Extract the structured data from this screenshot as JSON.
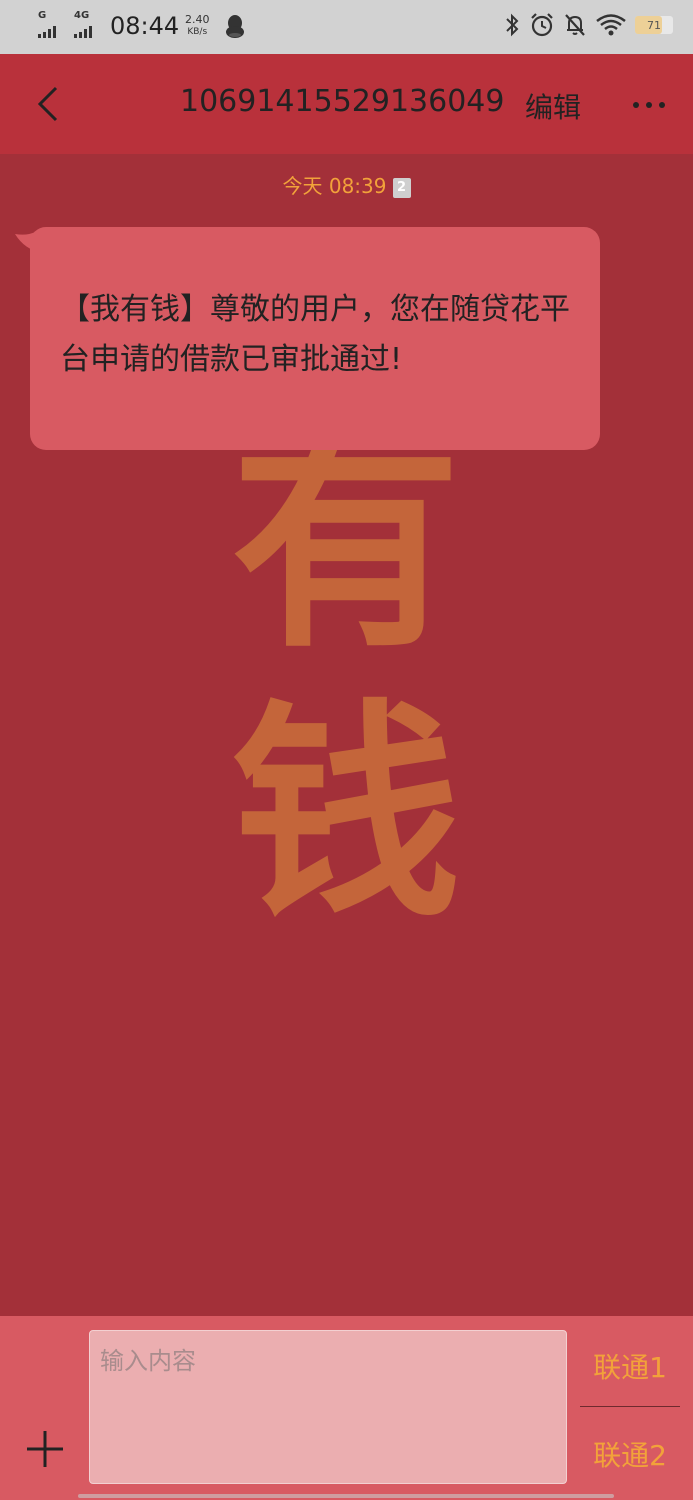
{
  "status_bar": {
    "net1": "G",
    "net2": "4G",
    "time": "08:44",
    "speed_value": "2.40",
    "speed_unit": "KB/s",
    "battery_level": "71",
    "icons": [
      "qq-icon",
      "bluetooth-icon",
      "alarm-icon",
      "mute-icon",
      "wifi-icon",
      "battery-icon"
    ]
  },
  "header": {
    "title": "10691415529136049",
    "edit_label": "编辑",
    "icons": [
      "back-arrow-icon",
      "more-icon"
    ]
  },
  "conversation": {
    "timestamp": "今天 08:39",
    "sim_badge": "2",
    "messages": [
      {
        "text": "【我有钱】尊敬的用户，您在随贷花平台申请的借款已审批通过!"
      }
    ],
    "watermark": [
      "有",
      "钱"
    ]
  },
  "compose": {
    "placeholder": "输入内容",
    "value": "",
    "sim1_label": "联通1",
    "sim2_label": "联通2",
    "icons": [
      "plus-icon"
    ]
  },
  "colors": {
    "header": "#b9313b",
    "chat_bg": "#a33039",
    "bubble": "#d85a62",
    "accent": "#f2a23a",
    "watermark": "#c4653a"
  }
}
